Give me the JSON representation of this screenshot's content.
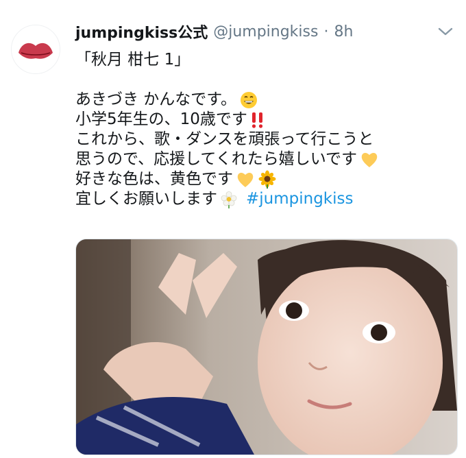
{
  "tweet": {
    "avatar_logo_text": "Jumping kiss",
    "display_name": "jumpingkiss公式",
    "handle": "@jumpingkiss",
    "separator": "·",
    "time": "8h",
    "lines": [
      "「秋月 柑七 1」",
      "",
      "あきづき かんなです。",
      "小学5年生の、10歳です",
      "これから、歌・ダンスを頑張って行こうと",
      "思うので、応援してくれたら嬉しいです",
      "好きな色は、黄色です",
      "宜しくお願いします"
    ],
    "hashtag": "#jumpingkiss"
  },
  "icons": {
    "caret": "chevron-down-icon",
    "emojis": [
      "grinning-face-icon",
      "double-exclamation-icon",
      "yellow-heart-icon",
      "yellow-heart-icon",
      "sunflower-icon",
      "blossom-icon"
    ]
  },
  "colors": {
    "name": "#14171a",
    "meta": "#657786",
    "hashtag": "#1b95e0",
    "logo": "#f0a020"
  }
}
